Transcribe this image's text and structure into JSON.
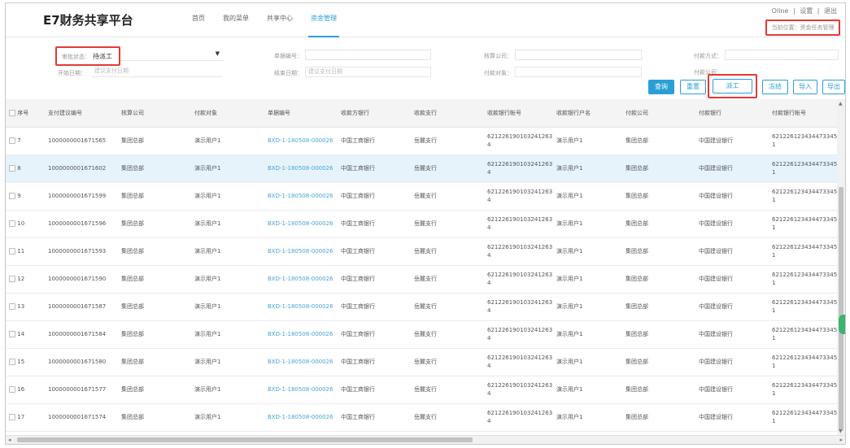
{
  "header": {
    "brand": "E7财务共享平台",
    "nav": [
      "首页",
      "我的菜单",
      "共享中心",
      "资金管理"
    ],
    "active_nav": 3,
    "top_links": [
      "Oline",
      "|",
      "设置",
      "|",
      "退出"
    ],
    "location": "当前位置：资金任务管理"
  },
  "filters": {
    "status_label": "审批状态：",
    "status_value": "待派工",
    "start_date_label": "开始日期：",
    "start_date_placeholder": "建议支付日期",
    "doc_no_label": "单据编号：",
    "end_date_label": "结束日期：",
    "end_date_placeholder": "建议支付日期",
    "company_label": "核算公司：",
    "target_label": "付款对象：",
    "method_label": "付款方式：",
    "pay_company_label": "付款公司："
  },
  "buttons": {
    "query": "查询",
    "reset": "重置",
    "dispatch": "派工",
    "freeze": "冻结",
    "import": "导入",
    "export": "导出"
  },
  "table": {
    "columns": [
      "序号",
      "支付建议编号",
      "核算公司",
      "付款对象",
      "单据编号",
      "收款方银行",
      "收款支行",
      "收款银行帐号",
      "收款银行户名",
      "付款公司",
      "付款银行",
      "付款银行帐号"
    ],
    "rows": [
      [
        "7",
        "1000000001671565",
        "集团总部",
        "演示用户1",
        "BXD-1-180508-000026",
        "中国工商银行",
        "岳麓支行",
        "621226190103241263 4",
        "演示用户1",
        "集团总部",
        "中国建设银行",
        "621226123434473345 1"
      ],
      [
        "8",
        "1000000001671602",
        "集团总部",
        "演示用户1",
        "BXD-1-180508-000026",
        "中国工商银行",
        "岳麓支行",
        "621226190103241263 4",
        "演示用户1",
        "集团总部",
        "中国建设银行",
        "621226123434473345 1"
      ],
      [
        "9",
        "1000000001671599",
        "集团总部",
        "演示用户1",
        "BXD-1-180508-000026",
        "中国工商银行",
        "岳麓支行",
        "621226190103241263 4",
        "演示用户1",
        "集团总部",
        "中国建设银行",
        "621226123434473345 1"
      ],
      [
        "10",
        "1000000001671596",
        "集团总部",
        "演示用户1",
        "BXD-1-180508-000026",
        "中国工商银行",
        "岳麓支行",
        "621226190103241263 4",
        "演示用户1",
        "集团总部",
        "中国建设银行",
        "621226123434473345 1"
      ],
      [
        "11",
        "1000000001671593",
        "集团总部",
        "演示用户1",
        "BXD-1-180508-000026",
        "中国工商银行",
        "岳麓支行",
        "621226190103241263 4",
        "演示用户1",
        "集团总部",
        "中国建设银行",
        "621226123434473345 1"
      ],
      [
        "12",
        "1000000001671590",
        "集团总部",
        "演示用户1",
        "BXD-1-180508-000026",
        "中国工商银行",
        "岳麓支行",
        "621226190103241263 4",
        "演示用户1",
        "集团总部",
        "中国建设银行",
        "621226123434473345 1"
      ],
      [
        "13",
        "1000000001671587",
        "集团总部",
        "演示用户1",
        "BXD-1-180508-000026",
        "中国工商银行",
        "岳麓支行",
        "621226190103241263 4",
        "演示用户1",
        "集团总部",
        "中国建设银行",
        "621226123434473345 1"
      ],
      [
        "14",
        "1000000001671584",
        "集团总部",
        "演示用户1",
        "BXD-1-180508-000026",
        "中国工商银行",
        "岳麓支行",
        "621226190103241263 4",
        "演示用户1",
        "集团总部",
        "中国建设银行",
        "621226123434473345 1"
      ],
      [
        "15",
        "1000000001671580",
        "集团总部",
        "演示用户1",
        "BXD-1-180508-000026",
        "中国工商银行",
        "岳麓支行",
        "621226190103241263 4",
        "演示用户1",
        "集团总部",
        "中国建设银行",
        "621226123434473345 1"
      ],
      [
        "16",
        "1000000001671577",
        "集团总部",
        "演示用户1",
        "BXD-1-180508-000026",
        "中国工商银行",
        "岳麓支行",
        "621226190103241263 4",
        "演示用户1",
        "集团总部",
        "中国建设银行",
        "621226123434473345 1"
      ],
      [
        "17",
        "1000000001671574",
        "集团总部",
        "演示用户1",
        "BXD-1-180508-000026",
        "中国工商银行",
        "岳麓支行",
        "621226190103241263 4",
        "演示用户1",
        "集团总部",
        "中国建设银行",
        "621226123434473345 1"
      ]
    ],
    "selected_row": 1
  },
  "colors": {
    "accent": "#2a9fd6",
    "highlight": "#e53935",
    "selected_row": "#e6f3fb"
  }
}
